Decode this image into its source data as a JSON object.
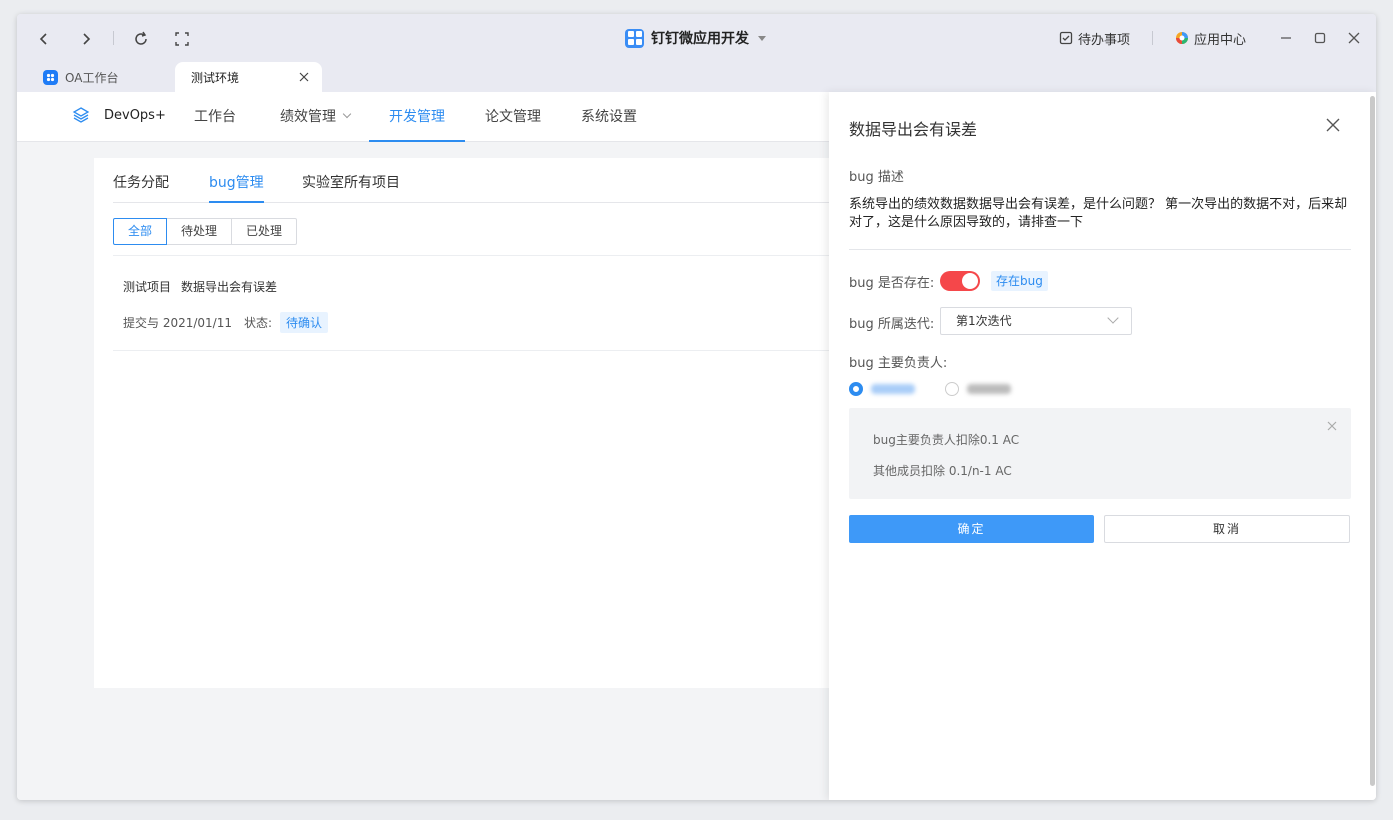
{
  "titlebar": {
    "app_title": "钉钉微应用开发",
    "todo_label": "待办事项",
    "app_center_label": "应用中心"
  },
  "tabs": [
    {
      "label": "OA工作台"
    },
    {
      "label": "测试环境"
    }
  ],
  "menu": {
    "brand": "DevOps+",
    "items": [
      {
        "label": "工作台"
      },
      {
        "label": "绩效管理"
      },
      {
        "label": "开发管理"
      },
      {
        "label": "论文管理"
      },
      {
        "label": "系统设置"
      }
    ]
  },
  "subtabs": [
    {
      "label": "任务分配"
    },
    {
      "label": "bug管理"
    },
    {
      "label": "实验室所有项目"
    }
  ],
  "filters": [
    {
      "label": "全部"
    },
    {
      "label": "待处理"
    },
    {
      "label": "已处理"
    }
  ],
  "bug_item": {
    "project": "测试项目",
    "title": "数据导出会有误差",
    "submit_text": "提交与 2021/01/11",
    "status_label": "状态:",
    "status_value": "待确认"
  },
  "drawer": {
    "title": "数据导出会有误差",
    "desc_label": "bug 描述",
    "desc_text": "系统导出的绩效数据数据导出会有误差，是什么问题？ 第一次导出的数据不对，后来却对了，这是什么原因导致的，请排查一下",
    "exists_label": "bug 是否存在:",
    "exists_on": true,
    "exists_tag": "存在bug",
    "iteration_label": "bug 所属迭代:",
    "iteration_value": "第1次迭代",
    "owner_label": "bug 主要负责人:",
    "info_line1": "bug主要负责人扣除0.1 AC",
    "info_line2": "其他成员扣除 0.1/n-1 AC",
    "confirm_label": "确定",
    "cancel_label": "取消"
  },
  "colors": {
    "accent": "#2d8cf0",
    "switch_on": "#f5474a",
    "primary_button": "#3e99f8"
  }
}
